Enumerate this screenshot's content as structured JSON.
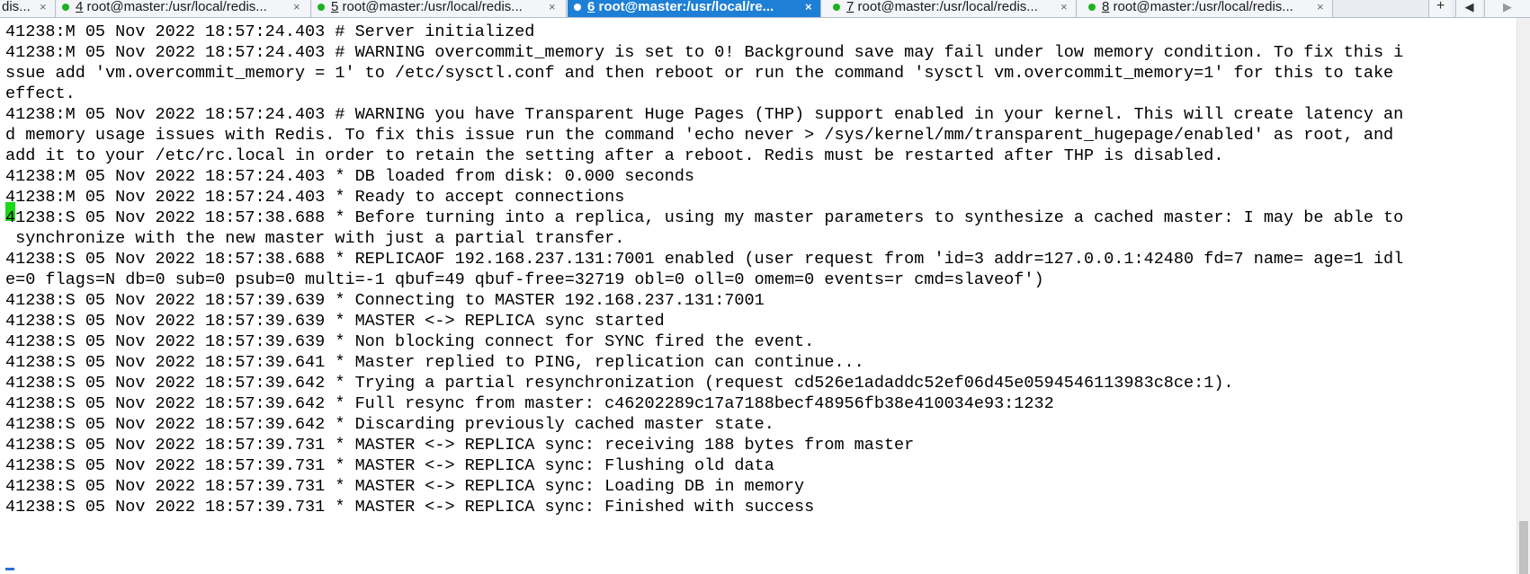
{
  "tabs": [
    {
      "label": "dis...",
      "active": false,
      "indicator": false
    },
    {
      "number": "4",
      "label": " root@master:/usr/local/redis...",
      "active": false,
      "indicator": true
    },
    {
      "number": "5",
      "label": " root@master:/usr/local/redis...",
      "active": false,
      "indicator": true
    },
    {
      "number": "6",
      "label": " root@master:/usr/local/re...",
      "active": true,
      "indicator": true
    },
    {
      "number": "7",
      "label": " root@master:/usr/local/redis...",
      "active": false,
      "indicator": true
    },
    {
      "number": "8",
      "label": " root@master:/usr/local/redis...",
      "active": false,
      "indicator": true
    }
  ],
  "tab_close_glyph": "×",
  "new_tab_glyph": "+",
  "scroll_tabs_left_glyph": "◀",
  "scroll_tabs_right_glyph": "▶",
  "terminal": {
    "lines": [
      "41238:M 05 Nov 2022 18:57:24.403 # Server initialized",
      "41238:M 05 Nov 2022 18:57:24.403 # WARNING overcommit_memory is set to 0! Background save may fail under low memory condition. To fix this i",
      "ssue add 'vm.overcommit_memory = 1' to /etc/sysctl.conf and then reboot or run the command 'sysctl vm.overcommit_memory=1' for this to take",
      "effect.",
      "41238:M 05 Nov 2022 18:57:24.403 # WARNING you have Transparent Huge Pages (THP) support enabled in your kernel. This will create latency an",
      "d memory usage issues with Redis. To fix this issue run the command 'echo never > /sys/kernel/mm/transparent_hugepage/enabled' as root, and",
      "add it to your /etc/rc.local in order to retain the setting after a reboot. Redis must be restarted after THP is disabled.",
      "41238:M 05 Nov 2022 18:57:24.403 * DB loaded from disk: 0.000 seconds",
      "41238:M 05 Nov 2022 18:57:24.403 * Ready to accept connections",
      "41238:S 05 Nov 2022 18:57:38.688 * Before turning into a replica, using my master parameters to synthesize a cached master: I may be able to",
      " synchronize with the new master with just a partial transfer.",
      "41238:S 05 Nov 2022 18:57:38.688 * REPLICAOF 192.168.237.131:7001 enabled (user request from 'id=3 addr=127.0.0.1:42480 fd=7 name= age=1 idl",
      "e=0 flags=N db=0 sub=0 psub=0 multi=-1 qbuf=49 qbuf-free=32719 obl=0 oll=0 omem=0 events=r cmd=slaveof')",
      "41238:S 05 Nov 2022 18:57:39.639 * Connecting to MASTER 192.168.237.131:7001",
      "41238:S 05 Nov 2022 18:57:39.639 * MASTER <-> REPLICA sync started",
      "41238:S 05 Nov 2022 18:57:39.639 * Non blocking connect for SYNC fired the event.",
      "41238:S 05 Nov 2022 18:57:39.641 * Master replied to PING, replication can continue...",
      "41238:S 05 Nov 2022 18:57:39.642 * Trying a partial resynchronization (request cd526e1adaddc52ef06d45e0594546113983c8ce:1).",
      "41238:S 05 Nov 2022 18:57:39.642 * Full resync from master: c46202289c17a7188becf48956fb38e410034e93:1232",
      "41238:S 05 Nov 2022 18:57:39.642 * Discarding previously cached master state.",
      "41238:S 05 Nov 2022 18:57:39.731 * MASTER <-> REPLICA sync: receiving 188 bytes from master",
      "41238:S 05 Nov 2022 18:57:39.731 * MASTER <-> REPLICA sync: Flushing old data",
      "41238:S 05 Nov 2022 18:57:39.731 * MASTER <-> REPLICA sync: Loading DB in memory",
      "41238:S 05 Nov 2022 18:57:39.731 * MASTER <-> REPLICA sync: Finished with success"
    ]
  },
  "colors": {
    "active_tab": "#1e7fd6",
    "status_dot": "#1fb11f",
    "cursor": "#18d818",
    "terminal_bg": "#ffffff",
    "terminal_fg": "#000000"
  }
}
